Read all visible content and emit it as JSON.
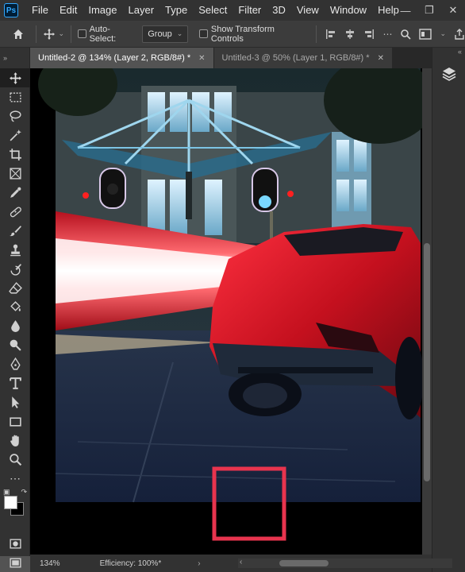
{
  "app": {
    "logo": "Ps",
    "menu": [
      "File",
      "Edit",
      "Image",
      "Layer",
      "Type",
      "Select",
      "Filter",
      "3D",
      "View",
      "Window",
      "Help"
    ]
  },
  "options": {
    "auto_select_label": "Auto-Select:",
    "auto_select_value": "Group",
    "show_transform_label": "Show Transform Controls"
  },
  "tabs": [
    {
      "label": "Untitled-2 @ 134% (Layer 2, RGB/8#) *",
      "active": true
    },
    {
      "label": "Untitled-3 @ 50% (Layer 1, RGB/8#) *",
      "active": false
    }
  ],
  "status": {
    "zoom": "134%",
    "info": "Efficiency: 100%*"
  },
  "tools": [
    "move-tool",
    "marquee-tool",
    "lasso-tool",
    "magic-wand-tool",
    "crop-tool",
    "frame-tool",
    "eyedropper-tool",
    "healing-tool",
    "brush-tool",
    "stamp-tool",
    "history-brush-tool",
    "eraser-tool",
    "paint-bucket-tool",
    "blur-tool",
    "dodge-tool",
    "pen-tool",
    "type-tool",
    "path-selection-tool",
    "rectangle-tool",
    "hand-tool",
    "zoom-tool",
    "more-tools"
  ],
  "colors": {
    "accent_box": "#e8344e",
    "foreground": "#ffffff",
    "background": "#000000"
  }
}
